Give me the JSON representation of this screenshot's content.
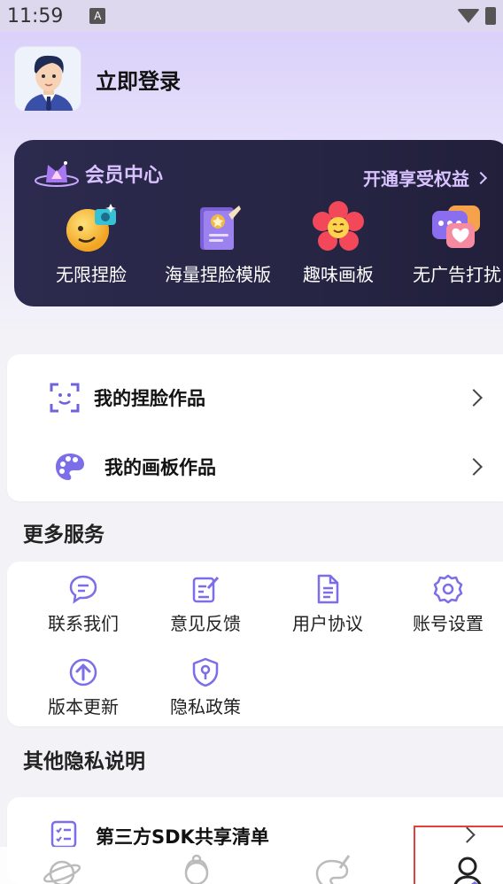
{
  "status_bar": {
    "time": "11:59",
    "notification_badge": "A"
  },
  "profile": {
    "login_label": "立即登录"
  },
  "vip": {
    "title": "会员中心",
    "open_label": "开通享受权益",
    "features": [
      {
        "label": "无限捏脸",
        "icon": "face-emoji-icon"
      },
      {
        "label": "海量捏脸模版",
        "icon": "template-book-icon"
      },
      {
        "label": "趣味画板",
        "icon": "flower-icon"
      },
      {
        "label": "无广告打扰",
        "icon": "no-ads-icon"
      }
    ]
  },
  "works": [
    {
      "label": "我的捏脸作品",
      "icon": "face-scan-icon"
    },
    {
      "label": "我的画板作品",
      "icon": "palette-icon"
    }
  ],
  "more_services": {
    "title": "更多服务",
    "items": [
      {
        "label": "联系我们",
        "icon": "chat-icon"
      },
      {
        "label": "意见反馈",
        "icon": "feedback-icon"
      },
      {
        "label": "用户协议",
        "icon": "document-icon"
      },
      {
        "label": "账号设置",
        "icon": "settings-icon"
      },
      {
        "label": "版本更新",
        "icon": "upload-icon"
      },
      {
        "label": "隐私政策",
        "icon": "privacy-shield-icon"
      }
    ]
  },
  "privacy": {
    "title": "其他隐私说明",
    "items": [
      {
        "label": "第三方SDK共享清单",
        "icon": "checklist-icon"
      }
    ]
  },
  "bottom_nav": [
    {
      "name": "planet",
      "icon": "planet-icon"
    },
    {
      "name": "character",
      "icon": "character-icon"
    },
    {
      "name": "palette",
      "icon": "paint-icon"
    },
    {
      "name": "profile",
      "icon": "person-icon"
    }
  ],
  "colors": {
    "accent": "#7b6ee8",
    "vip_bg": "#2a2848",
    "vip_text": "#d9c2ff",
    "highlight": "#e0413a"
  }
}
